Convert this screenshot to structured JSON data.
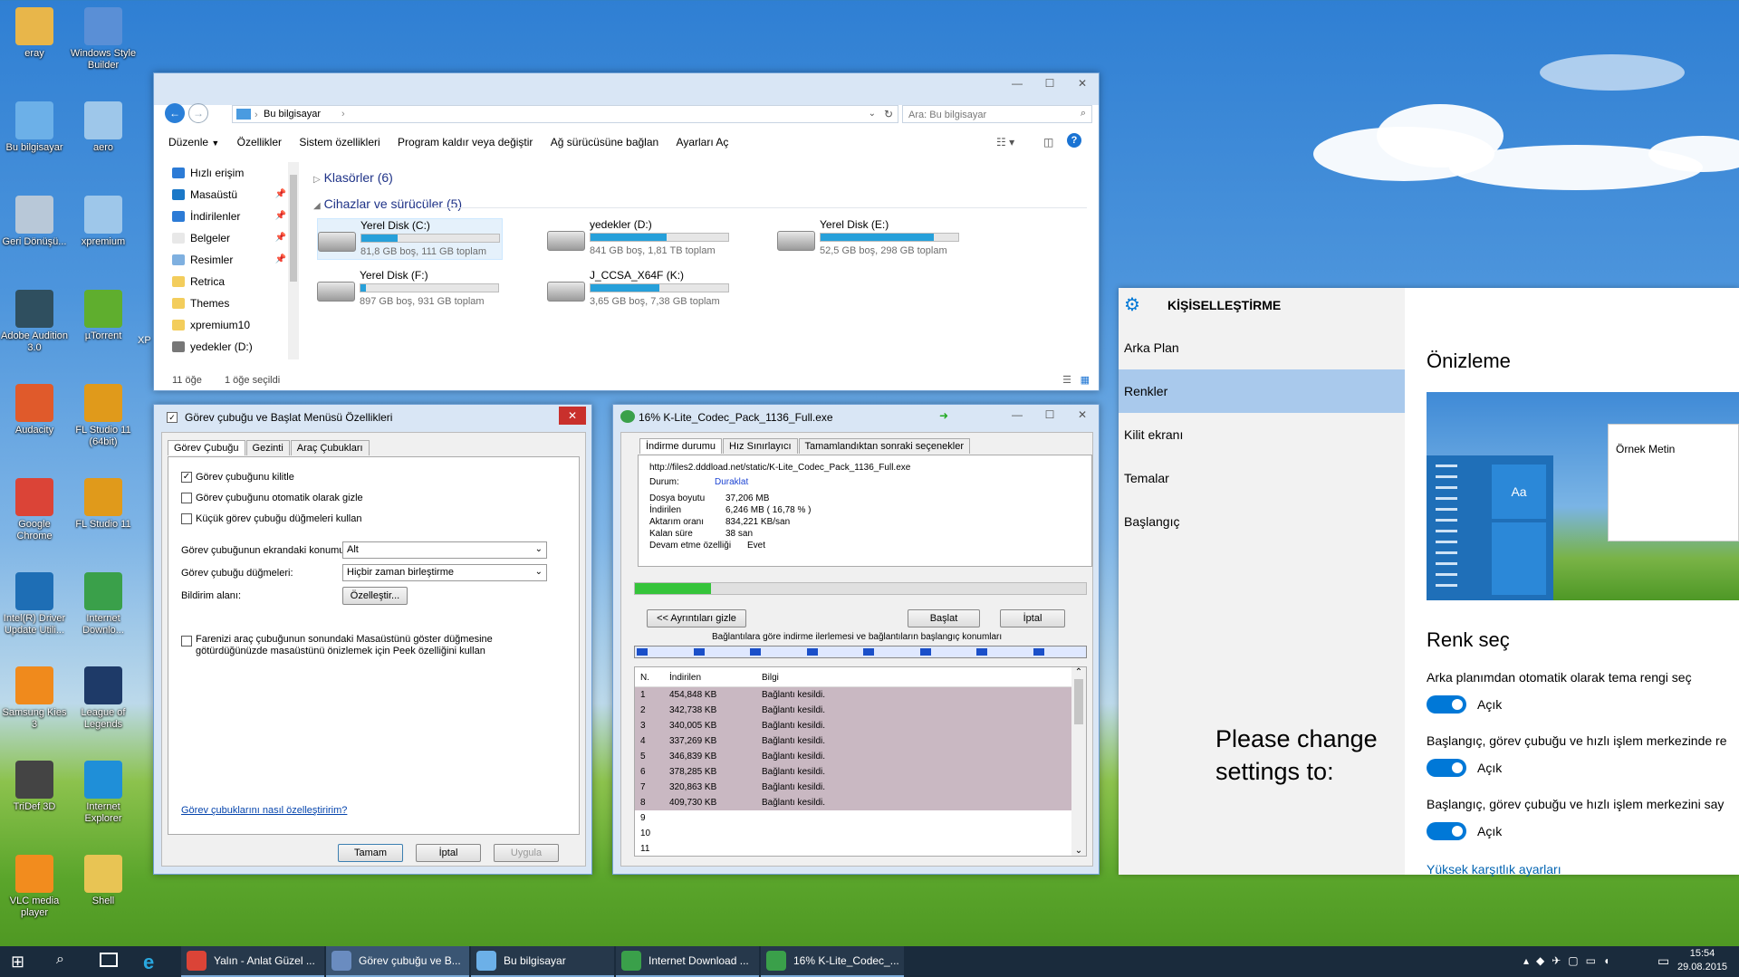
{
  "desktop": {
    "icons": [
      {
        "label": "eray",
        "color": "#e8b64a"
      },
      {
        "label": "Windows Style Builder",
        "color": "#5a8fd6"
      },
      {
        "label": "Bu bilgisayar",
        "color": "#6cb0e8"
      },
      {
        "label": "aero",
        "color": "#9ec7ea"
      },
      {
        "label": "Geri Dönüşü...",
        "color": "#b8c8d8"
      },
      {
        "label": "xpremium",
        "color": "#9ec7ea"
      },
      {
        "label": "Adobe Audition 3.0",
        "color": "#2f4f5f"
      },
      {
        "label": "µTorrent",
        "color": "#5fae2e"
      },
      {
        "label": "Audacity",
        "color": "#e05a2b"
      },
      {
        "label": "FL Studio 11 (64bit)",
        "color": "#e09a1b"
      },
      {
        "label": "Google Chrome",
        "color": "#db4437"
      },
      {
        "label": "FL Studio 11",
        "color": "#e09a1b"
      },
      {
        "label": "Intel(R) Driver Update Utili...",
        "color": "#1e6eb5"
      },
      {
        "label": "Internet Downlo...",
        "color": "#3aa04a"
      },
      {
        "label": "Samsung Kies 3",
        "color": "#f08a1c"
      },
      {
        "label": "League of Legends",
        "color": "#1e3a68"
      },
      {
        "label": "TriDef 3D",
        "color": "#444"
      },
      {
        "label": "Internet Explorer",
        "color": "#1f8fd8"
      },
      {
        "label": "VLC media player",
        "color": "#f28c1e"
      },
      {
        "label": "Shell",
        "color": "#e8c454"
      }
    ],
    "partial_label": "XP"
  },
  "explorer": {
    "address": "Bu bilgisayar",
    "search_placeholder": "Ara: Bu bilgisayar",
    "menu": [
      "Düzenle",
      "Özellikler",
      "Sistem özellikleri",
      "Program kaldır veya değiştir",
      "Ağ sürücüsüne bağlan",
      "Ayarları Aç"
    ],
    "nav": [
      {
        "label": "Hızlı erişim",
        "color": "#2c7bd6"
      },
      {
        "label": "Masaüstü",
        "color": "#1a78c8"
      },
      {
        "label": "İndirilenler",
        "color": "#2c7bd6"
      },
      {
        "label": "Belgeler",
        "color": "#e8e8e8"
      },
      {
        "label": "Resimler",
        "color": "#7fb0e0"
      },
      {
        "label": "Retrica",
        "color": "#f3cd5c"
      },
      {
        "label": "Themes",
        "color": "#f3cd5c"
      },
      {
        "label": "xpremium10",
        "color": "#f3cd5c"
      },
      {
        "label": "yedekler (D:)",
        "color": "#777"
      }
    ],
    "folders_header": "Klasörler (6)",
    "devices_header": "Cihazlar ve sürücüler (5)",
    "drives": [
      {
        "name": "Yerel Disk (C:)",
        "info": "81,8 GB boş, 111 GB toplam",
        "used": 0.26
      },
      {
        "name": "yedekler (D:)",
        "info": "841 GB boş, 1,81 TB toplam",
        "used": 0.55
      },
      {
        "name": "Yerel Disk (E:)",
        "info": "52,5 GB boş, 298 GB toplam",
        "used": 0.82
      },
      {
        "name": "Yerel Disk (F:)",
        "info": "897 GB boş, 931 GB toplam",
        "used": 0.04
      },
      {
        "name": "J_CCSA_X64F (K:)",
        "info": "3,65 GB boş, 7,38 GB toplam",
        "used": 0.5
      }
    ],
    "status_count": "11 öğe",
    "status_selected": "1 öğe seçildi"
  },
  "taskbar_props": {
    "title": "Görev çubuğu ve Başlat Menüsü Özellikleri",
    "tabs": [
      "Görev Çubuğu",
      "Gezinti",
      "Araç Çubukları"
    ],
    "checks": [
      {
        "label": "Görev çubuğunu kilitle",
        "checked": true
      },
      {
        "label": "Görev çubuğunu otomatik olarak gizle",
        "checked": false
      },
      {
        "label": "Küçük görev çubuğu düğmeleri kullan",
        "checked": false
      }
    ],
    "position_label": "Görev çubuğunun ekrandaki konumu:",
    "position_value": "Alt",
    "buttons_label": "Görev çubuğu düğmeleri:",
    "buttons_value": "Hiçbir zaman birleştirme",
    "notify_label": "Bildirim alanı:",
    "customize": "Özelleştir...",
    "peek_text": "Farenizi araç çubuğunun sonundaki Masaüstünü göster düğmesine götürdüğünüzde masaüstünü önizlemek için Peek özelliğini kullan",
    "link": "Görev çubuklarını nasıl özelleştiririm?",
    "ok": "Tamam",
    "cancel": "İptal",
    "apply": "Uygula"
  },
  "idm": {
    "title": "16% K-Lite_Codec_Pack_1136_Full.exe",
    "tabs": [
      "İndirme durumu",
      "Hız Sınırlayıcı",
      "Tamamlandıktan sonraki seçenekler"
    ],
    "url": "http://files2.dddload.net/static/K-Lite_Codec_Pack_1136_Full.exe",
    "status_label": "Durum:",
    "status_value": "Duraklat",
    "rows": [
      {
        "label": "Dosya boyutu",
        "value": "37,206  MB"
      },
      {
        "label": "İndirilen",
        "value": "6,246  MB  ( 16,78 % )"
      },
      {
        "label": "Aktarım oranı",
        "value": "834,221  KB/san"
      },
      {
        "label": "Kalan süre",
        "value": "38 san"
      },
      {
        "label": "Devam etme özelliği",
        "value": "Evet"
      }
    ],
    "progress": 0.1678,
    "details_btn": "<< Ayrıntıları gizle",
    "start_btn": "Başlat",
    "cancel_btn": "İptal",
    "conn_caption": "Bağlantılara göre indirme ilerlemesi ve bağlantıların başlangıç konumları",
    "col_n": "N.",
    "col_dl": "İndirilen",
    "col_info": "Bilgi",
    "connections": [
      {
        "n": "1",
        "dl": "454,848  KB",
        "info": "Bağlantı kesildi."
      },
      {
        "n": "2",
        "dl": "342,738  KB",
        "info": "Bağlantı kesildi."
      },
      {
        "n": "3",
        "dl": "340,005  KB",
        "info": "Bağlantı kesildi."
      },
      {
        "n": "4",
        "dl": "337,269  KB",
        "info": "Bağlantı kesildi."
      },
      {
        "n": "5",
        "dl": "346,839  KB",
        "info": "Bağlantı kesildi."
      },
      {
        "n": "6",
        "dl": "378,285  KB",
        "info": "Bağlantı kesildi."
      },
      {
        "n": "7",
        "dl": "320,863  KB",
        "info": "Bağlantı kesildi."
      },
      {
        "n": "8",
        "dl": "409,730  KB",
        "info": "Bağlantı kesildi."
      },
      {
        "n": "9",
        "dl": "",
        "info": ""
      },
      {
        "n": "10",
        "dl": "",
        "info": ""
      },
      {
        "n": "11",
        "dl": "",
        "info": ""
      }
    ]
  },
  "settings": {
    "title": "KİŞİSELLEŞTİRME",
    "nav": [
      "Arka Plan",
      "Renkler",
      "Kilit ekranı",
      "Temalar",
      "Başlangıç"
    ],
    "selected_nav": "Renkler",
    "preview_heading": "Önizleme",
    "sample_text": "Örnek Metin",
    "tile_text": "Aa",
    "color_heading": "Renk seç",
    "options": [
      {
        "label": "Arka planımdan otomatik olarak tema rengi seç",
        "state": "Açık"
      },
      {
        "label": "Başlangıç, görev çubuğu ve hızlı işlem merkezinde re",
        "state": "Açık"
      },
      {
        "label": "Başlangıç, görev çubuğu ve hızlı işlem merkezini say",
        "state": "Açık"
      }
    ],
    "contrast_link": "Yüksek karşıtlık ayarları",
    "note": "Please change settings to:"
  },
  "taskbar": {
    "items": [
      {
        "label": "Yalın - Anlat Güzel ...",
        "color": "#db4437"
      },
      {
        "label": "Görev çubuğu ve B...",
        "color": "#6a8cc0"
      },
      {
        "label": "Bu bilgisayar",
        "color": "#6cb0e8"
      },
      {
        "label": "Internet Download ...",
        "color": "#3aa04a"
      },
      {
        "label": "16% K-Lite_Codec_...",
        "color": "#3aa04a"
      }
    ],
    "time": "15:54",
    "date": "29.08.2015"
  }
}
